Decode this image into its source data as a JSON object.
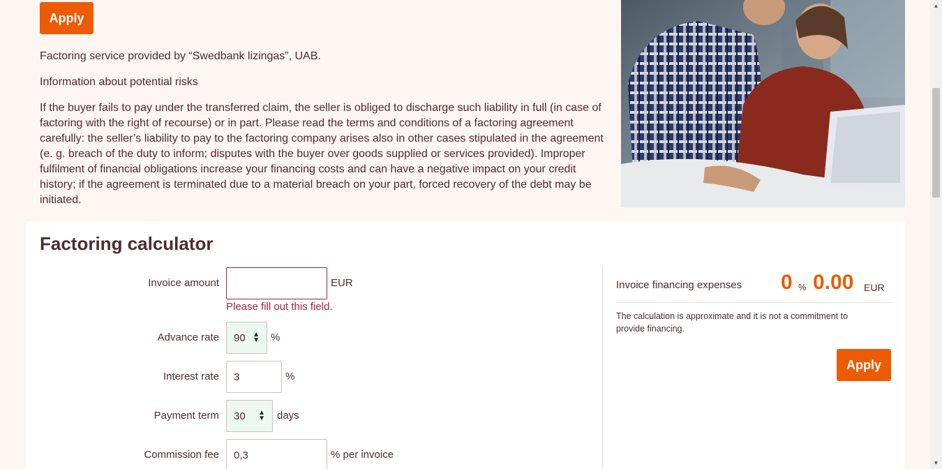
{
  "header": {
    "apply_label": "Apply"
  },
  "intro": {
    "provider": "Factoring service provided by “Swedbank lizingas”, UAB.",
    "risks_heading": "Information about potential risks",
    "risks_text": "If the buyer fails to pay under the transferred claim, the seller is obliged to discharge such liability in full (in case of factoring with the right of recourse) or in part. Please read the terms and conditions of a factoring agreement carefully: the seller’s liability to pay to the factoring company arises also in other cases stipulated in the agreement (e. g. breach of the duty to inform; disputes with the buyer over goods supplied or services provided). Improper fulfilment of financial obligations increase your financing costs and can have a negative impact on your credit history; if the agreement is terminated due to a material breach on your part, forced recovery of the debt may be initiated."
  },
  "calculator": {
    "title": "Factoring calculator",
    "invoice_amount": {
      "label": "Invoice amount",
      "value": "",
      "unit": "EUR",
      "error": "Please fill out this field."
    },
    "advance_rate": {
      "label": "Advance rate",
      "value": "90",
      "unit": "%"
    },
    "interest_rate": {
      "label": "Interest rate",
      "value": "3",
      "unit": "%"
    },
    "payment_term": {
      "label": "Payment term",
      "value": "30",
      "unit": "days"
    },
    "commission_fee": {
      "label": "Commission fee",
      "value": "0,3",
      "unit": "% per invoice"
    },
    "result": {
      "label": "Invoice financing expenses",
      "percent": "0",
      "percent_sign": "%",
      "amount": "0.00",
      "currency": "EUR",
      "disclaimer": "The calculation is approximate and it is not a commitment to provide financing."
    },
    "apply_label": "Apply"
  },
  "icons": {
    "select_arrows": "up-down-arrows-icon",
    "scroll_up": "scroll-up-icon",
    "scroll_down": "scroll-down-icon"
  },
  "colors": {
    "accent": "#ee5b05",
    "text": "#512b2b",
    "error": "#a2223b",
    "page_bg": "#fdf6f1"
  }
}
